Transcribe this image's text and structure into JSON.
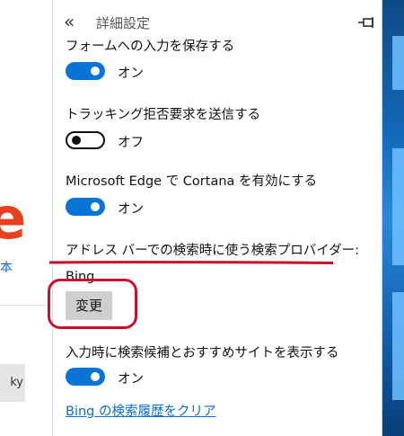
{
  "panel": {
    "title": "詳細設定"
  },
  "settings": {
    "form_save": {
      "label": "フォームへの入力を保存する",
      "state": "オン"
    },
    "do_not_track": {
      "label": "トラッキング拒否要求を送信する",
      "state": "オフ"
    },
    "cortana": {
      "label": "Microsoft Edge で Cortana を有効にする",
      "state": "オン"
    },
    "search_provider": {
      "label": "アドレス バーでの検索時に使う検索プロバイダー:",
      "value": "Bing",
      "button": "変更"
    },
    "suggestions": {
      "label": "入力時に検索候補とおすすめサイトを表示する",
      "state": "オン"
    },
    "clear_link": "Bing の検索履歴をクリア"
  },
  "background": {
    "logo_letter": "e",
    "logo_link": "本",
    "button_fragment": "ky"
  },
  "colors": {
    "toggle_on": "#0a74d6",
    "link": "#0a6fd4",
    "annotation_red": "#c8102e",
    "logo": "#e8401f"
  },
  "icons": [
    "back-icon",
    "pin-icon"
  ]
}
